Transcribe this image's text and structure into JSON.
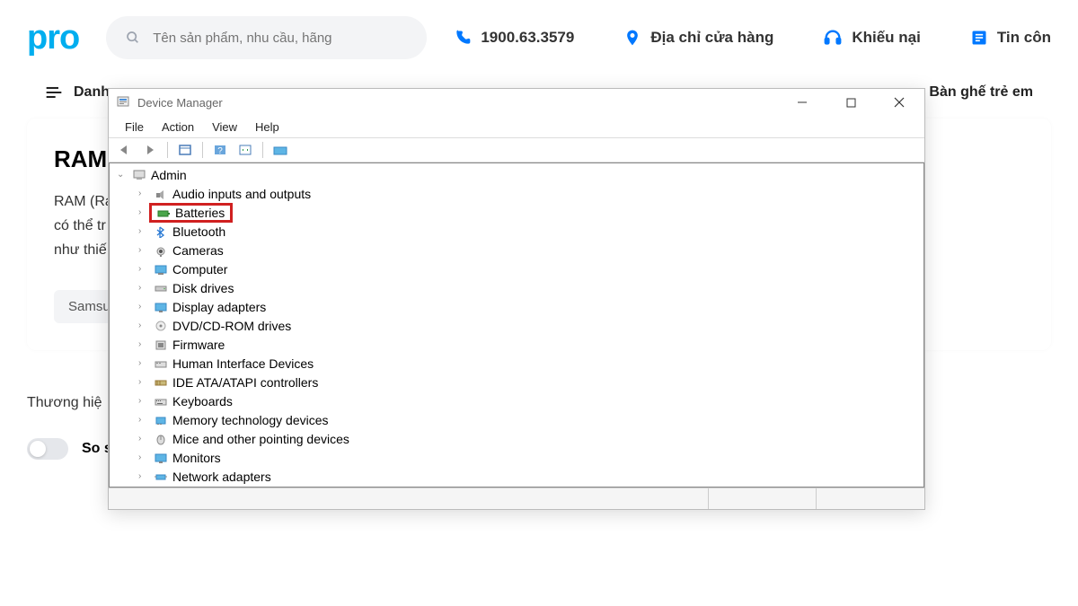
{
  "header": {
    "logo": "pro",
    "search_placeholder": "Tên sản phẩm, nhu cầu, hãng",
    "phone": "1900.63.3579",
    "address": "Địa chỉ cửa hàng",
    "complaint": "Khiếu nại",
    "news": "Tin côn"
  },
  "cat": {
    "danh_muc": "Danh",
    "right": "Bàn ghế trẻ em"
  },
  "card": {
    "title": "RAM",
    "p1": "RAM (Ra",
    "p2": "có thể tr",
    "p3": "như thiế",
    "tag": "Samsu"
  },
  "brand_label": "Thương hiệ",
  "compare": "So sánh",
  "dm": {
    "title": "Device Manager",
    "menus": [
      "File",
      "Action",
      "View",
      "Help"
    ],
    "root": "Admin",
    "items": [
      {
        "label": "Audio inputs and outputs"
      },
      {
        "label": "Batteries",
        "highlight": true
      },
      {
        "label": "Bluetooth"
      },
      {
        "label": "Cameras"
      },
      {
        "label": "Computer"
      },
      {
        "label": "Disk drives"
      },
      {
        "label": "Display adapters"
      },
      {
        "label": "DVD/CD-ROM drives"
      },
      {
        "label": "Firmware"
      },
      {
        "label": "Human Interface Devices"
      },
      {
        "label": "IDE ATA/ATAPI controllers"
      },
      {
        "label": "Keyboards"
      },
      {
        "label": "Memory technology devices"
      },
      {
        "label": "Mice and other pointing devices"
      },
      {
        "label": "Monitors"
      },
      {
        "label": "Network adapters"
      }
    ]
  }
}
